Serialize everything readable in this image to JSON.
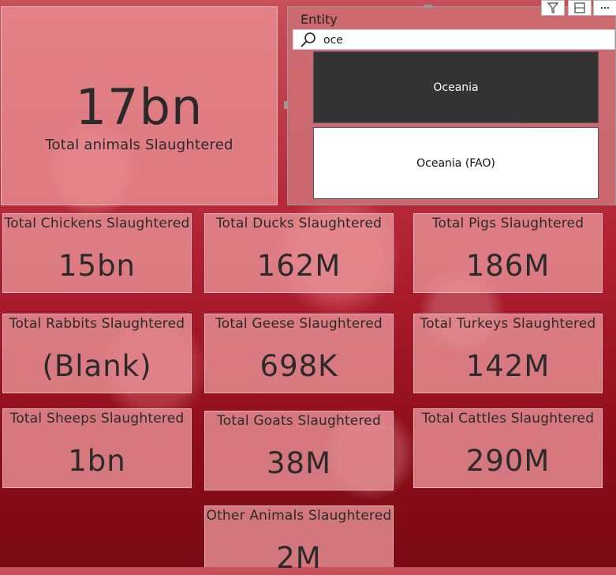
{
  "total": {
    "value": "17bn",
    "label": "Total animals Slaughtered"
  },
  "slicer": {
    "title": "Entity",
    "search_value": "oce",
    "options": [
      "Oceania",
      "Oceania (FAO)"
    ]
  },
  "cards": [
    {
      "label": "Total Chickens Slaughtered",
      "value": "15bn"
    },
    {
      "label": "Total Ducks Slaughtered",
      "value": "162M"
    },
    {
      "label": "Total Pigs Slaughtered",
      "value": "186M"
    },
    {
      "label": "Total Rabbits Slaughtered",
      "value": "(Blank)"
    },
    {
      "label": "Total Geese Slaughtered",
      "value": "698K"
    },
    {
      "label": "Total Turkeys Slaughtered",
      "value": "142M"
    },
    {
      "label": "Total Sheeps Slaughtered",
      "value": "1bn"
    },
    {
      "label": "Total Goats Slaughtered",
      "value": "38M"
    },
    {
      "label": "Total Cattles Slaughtered",
      "value": "290M"
    },
    {
      "label": "Other Animals Slaughtered",
      "value": "2M"
    }
  ],
  "toolbar": {
    "icons": [
      "filter-icon",
      "focus-mode-icon",
      "more-options-icon"
    ]
  },
  "colors": {
    "background": "#b02030",
    "card": "#eb969b",
    "selected_option": "#333333"
  }
}
